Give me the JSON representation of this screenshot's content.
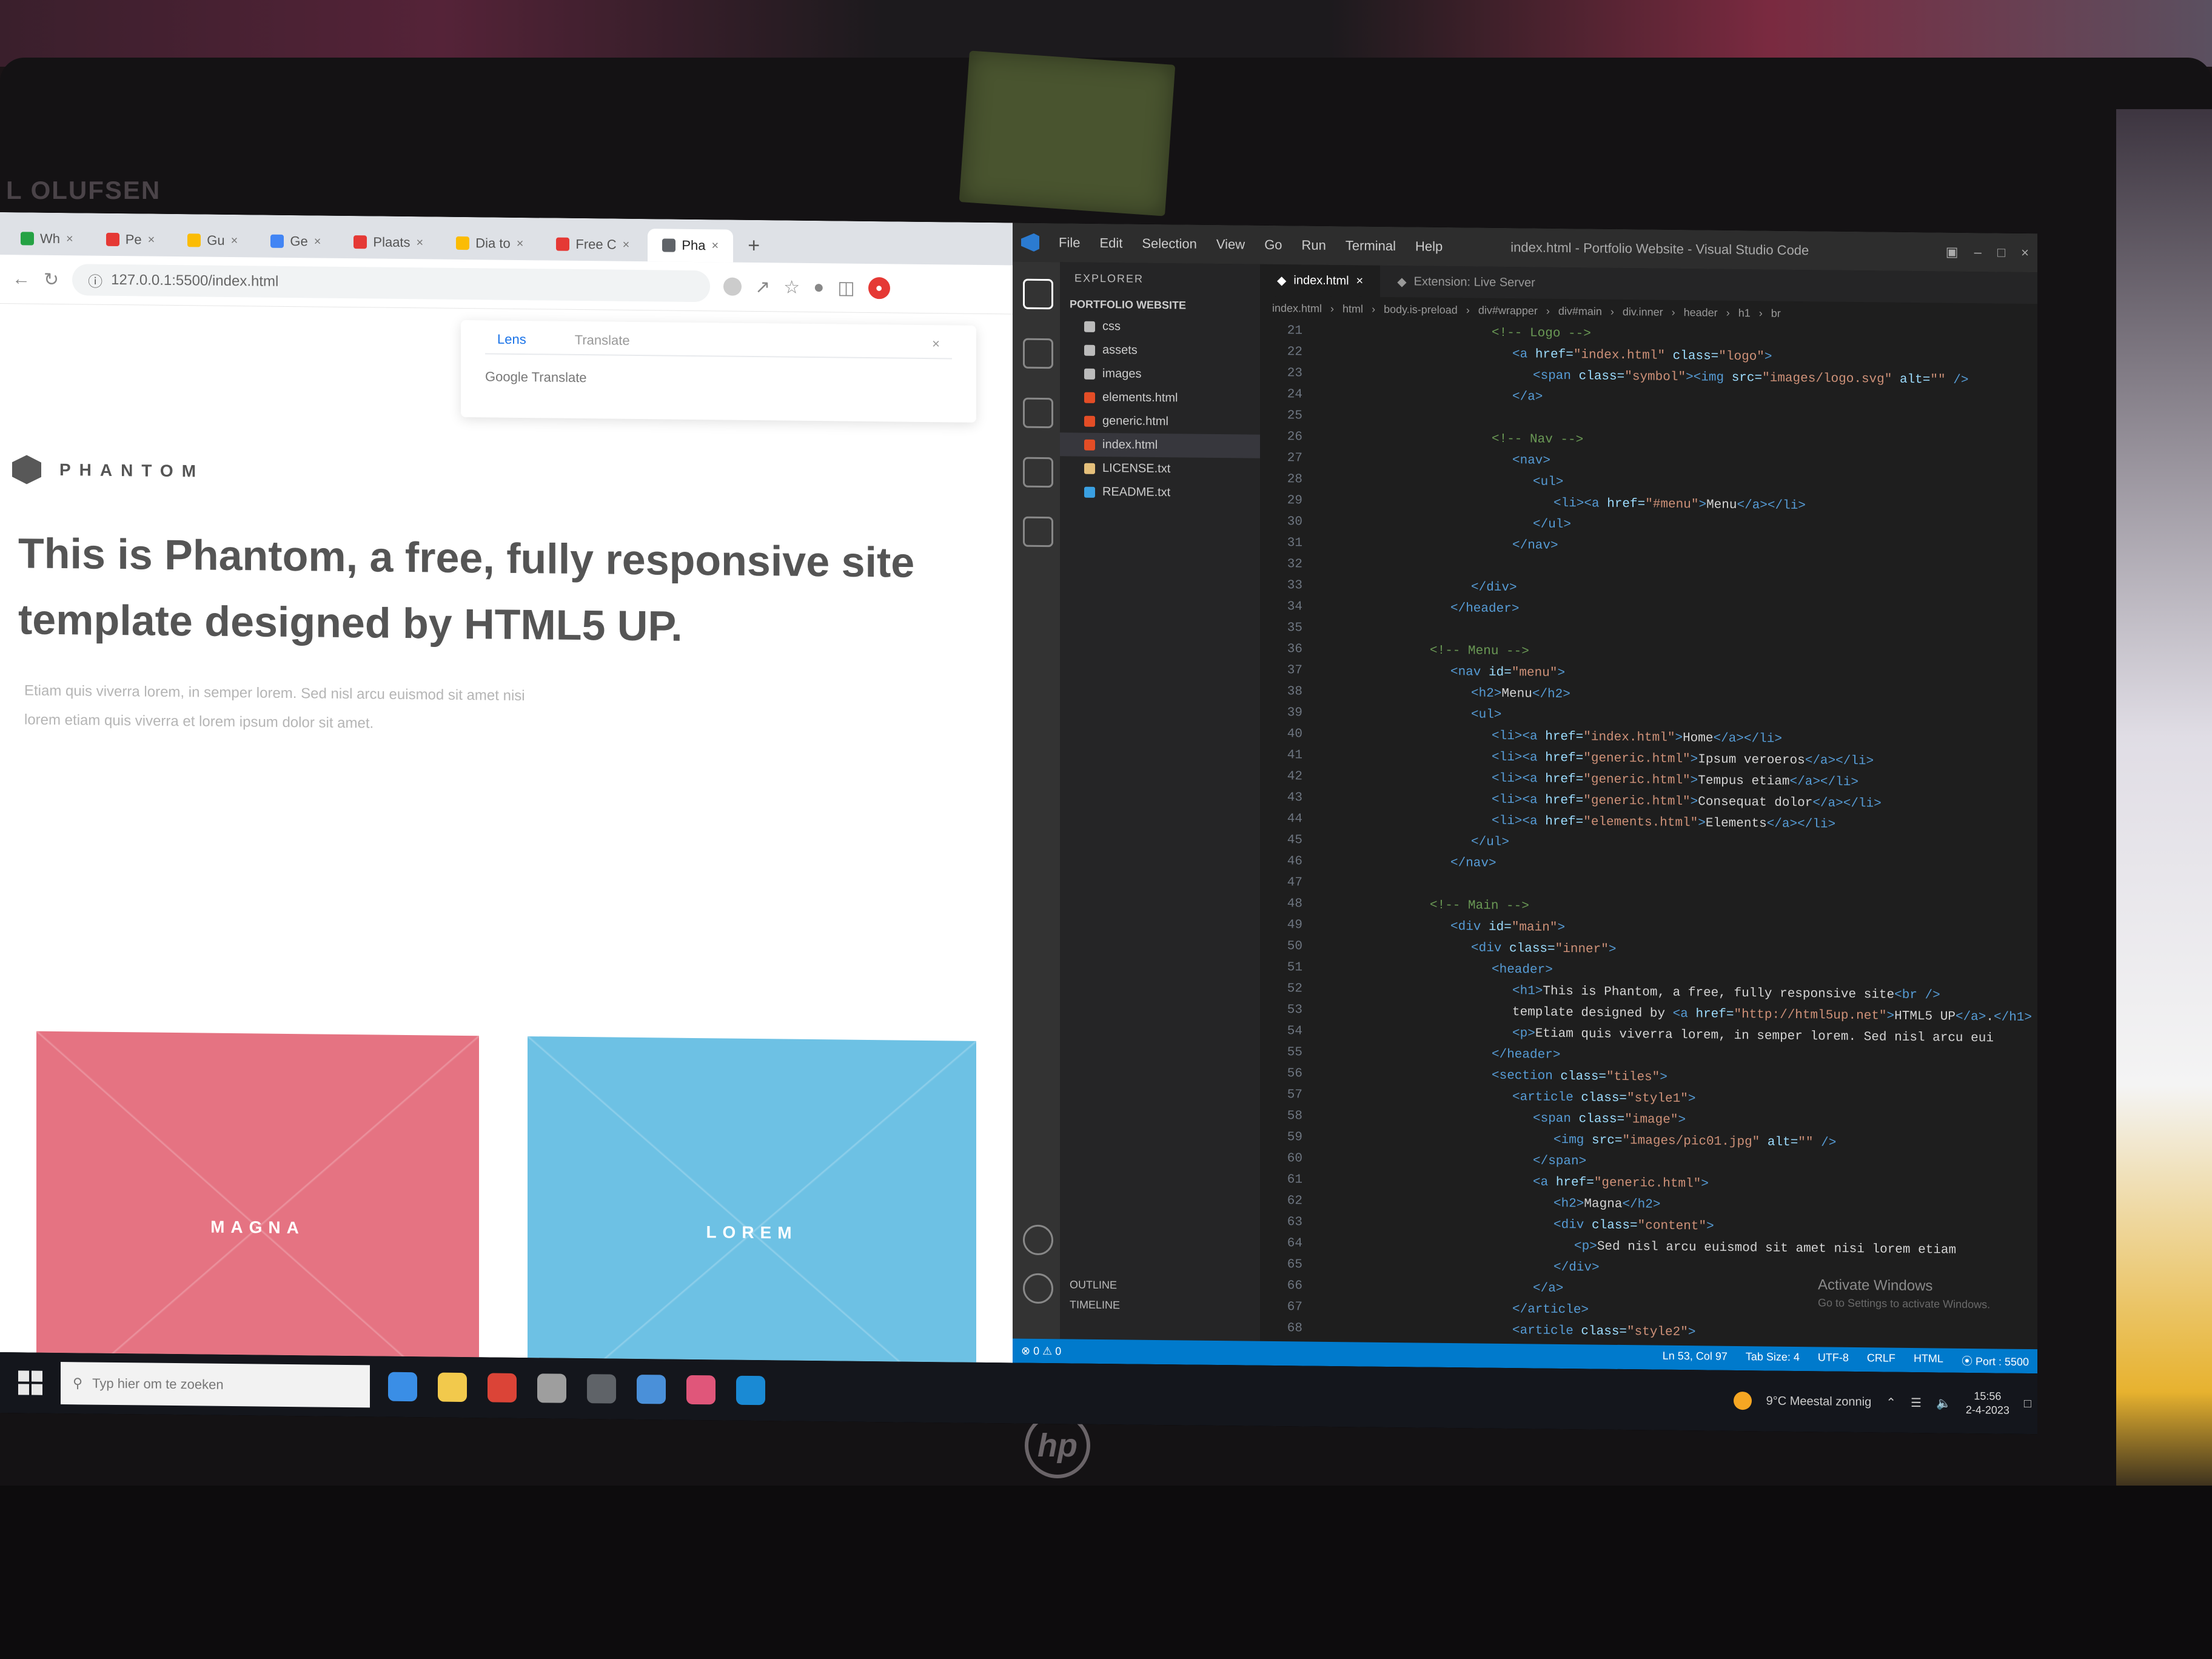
{
  "surroundings": {
    "monitor_brand": "L OLUFSEN",
    "laptop_logo": "hp"
  },
  "browser": {
    "tabs": [
      {
        "label": "Wh",
        "color": "#25a244"
      },
      {
        "label": "Pe",
        "color": "#e53935"
      },
      {
        "label": "Gu",
        "color": "#fbbc04"
      },
      {
        "label": "Ge",
        "color": "#4285f4"
      },
      {
        "label": "Plaats",
        "color": "#e53935"
      },
      {
        "label": "Dia to",
        "color": "#fbbc04"
      },
      {
        "label": "Free C",
        "color": "#e53935"
      },
      {
        "label": "Pha",
        "color": "#5f6368",
        "active": true
      }
    ],
    "address": "127.0.0.1:5500/index.html",
    "popup": {
      "tab_active": "Lens",
      "tab_other": "Translate",
      "source": "Google Translate"
    },
    "site": {
      "logo_text": "PHANTOM",
      "hero_line1": "This is Phantom, a free, fully responsive site",
      "hero_line2": "template designed by HTML5 UP.",
      "lead_line1": "Etiam quis viverra lorem, in semper lorem. Sed nisl arcu euismod sit amet nisi",
      "lead_line2": "lorem etiam quis viverra et lorem ipsum dolor sit amet.",
      "tiles": [
        {
          "label": "MAGNA",
          "color": "#e57382"
        },
        {
          "label": "LOREM",
          "color": "#6dc1e4"
        },
        {
          "label": "",
          "color": "#3eb08a"
        },
        {
          "label": "",
          "color": "#c766a8"
        }
      ]
    }
  },
  "vscode": {
    "menu": [
      "File",
      "Edit",
      "Selection",
      "View",
      "Go",
      "Run",
      "Terminal",
      "Help"
    ],
    "window_title": "index.html - Portfolio Website - Visual Studio Code",
    "sidebar": {
      "header": "EXPLORER",
      "project": "PORTFOLIO WEBSITE",
      "items": [
        {
          "label": "css",
          "color": "#bbb"
        },
        {
          "label": "assets",
          "color": "#bbb"
        },
        {
          "label": "images",
          "color": "#bbb"
        },
        {
          "label": "elements.html",
          "color": "#e44d26"
        },
        {
          "label": "generic.html",
          "color": "#e44d26"
        },
        {
          "label": "index.html",
          "color": "#e44d26",
          "selected": true
        },
        {
          "label": "LICENSE.txt",
          "color": "#e5c07b"
        },
        {
          "label": "README.txt",
          "color": "#3aa0e2"
        }
      ],
      "outline": "OUTLINE",
      "timeline": "TIMELINE"
    },
    "tabs": [
      {
        "label": "index.html",
        "active": true
      },
      {
        "label": "Extension: Live Server",
        "active": false
      }
    ],
    "breadcrumbs": [
      "index.html",
      "html",
      "body.is-preload",
      "div#wrapper",
      "div#main",
      "div.inner",
      "header",
      "h1",
      "br"
    ],
    "code": [
      {
        "n": "21",
        "t": [
          [
            "cm",
            "<!-- Logo -->"
          ]
        ],
        "i": 8
      },
      {
        "n": "22",
        "t": [
          [
            "tag",
            "<a "
          ],
          [
            "at",
            "href="
          ],
          [
            "st",
            "\"index.html\""
          ],
          [
            "at",
            " class="
          ],
          [
            "st",
            "\"logo\""
          ],
          [
            "tag",
            ">"
          ]
        ],
        "i": 9
      },
      {
        "n": "23",
        "t": [
          [
            "tag",
            "<span "
          ],
          [
            "at",
            "class="
          ],
          [
            "st",
            "\"symbol\""
          ],
          [
            "tag",
            "><img "
          ],
          [
            "at",
            "src="
          ],
          [
            "st",
            "\"images/logo.svg\""
          ],
          [
            "at",
            " alt="
          ],
          [
            "st",
            "\"\""
          ],
          [
            "tag",
            " />"
          ]
        ],
        "i": 10
      },
      {
        "n": "24",
        "t": [
          [
            "tag",
            "</a>"
          ]
        ],
        "i": 9
      },
      {
        "n": "25",
        "t": [],
        "i": 0
      },
      {
        "n": "26",
        "t": [
          [
            "cm",
            "<!-- Nav -->"
          ]
        ],
        "i": 8
      },
      {
        "n": "27",
        "t": [
          [
            "tag",
            "<nav>"
          ]
        ],
        "i": 9
      },
      {
        "n": "28",
        "t": [
          [
            "tag",
            "<ul>"
          ]
        ],
        "i": 10
      },
      {
        "n": "29",
        "t": [
          [
            "tag",
            "<li><a "
          ],
          [
            "at",
            "href="
          ],
          [
            "st",
            "\"#menu\""
          ],
          [
            "tag",
            ">"
          ],
          [
            "tx",
            "Menu"
          ],
          [
            "tag",
            "</a></li>"
          ]
        ],
        "i": 11
      },
      {
        "n": "30",
        "t": [
          [
            "tag",
            "</ul>"
          ]
        ],
        "i": 10
      },
      {
        "n": "31",
        "t": [
          [
            "tag",
            "</nav>"
          ]
        ],
        "i": 9
      },
      {
        "n": "32",
        "t": [],
        "i": 0
      },
      {
        "n": "33",
        "t": [
          [
            "tag",
            "</div>"
          ]
        ],
        "i": 7
      },
      {
        "n": "34",
        "t": [
          [
            "tag",
            "</header>"
          ]
        ],
        "i": 6
      },
      {
        "n": "35",
        "t": [],
        "i": 0
      },
      {
        "n": "36",
        "t": [
          [
            "cm",
            "<!-- Menu -->"
          ]
        ],
        "i": 5
      },
      {
        "n": "37",
        "t": [
          [
            "tag",
            "<nav "
          ],
          [
            "at",
            "id="
          ],
          [
            "st",
            "\"menu\""
          ],
          [
            "tag",
            ">"
          ]
        ],
        "i": 6
      },
      {
        "n": "38",
        "t": [
          [
            "tag",
            "<h2>"
          ],
          [
            "tx",
            "Menu"
          ],
          [
            "tag",
            "</h2>"
          ]
        ],
        "i": 7
      },
      {
        "n": "39",
        "t": [
          [
            "tag",
            "<ul>"
          ]
        ],
        "i": 7
      },
      {
        "n": "40",
        "t": [
          [
            "tag",
            "<li><a "
          ],
          [
            "at",
            "href="
          ],
          [
            "st",
            "\"index.html\""
          ],
          [
            "tag",
            ">"
          ],
          [
            "tx",
            "Home"
          ],
          [
            "tag",
            "</a></li>"
          ]
        ],
        "i": 8
      },
      {
        "n": "41",
        "t": [
          [
            "tag",
            "<li><a "
          ],
          [
            "at",
            "href="
          ],
          [
            "st",
            "\"generic.html\""
          ],
          [
            "tag",
            ">"
          ],
          [
            "tx",
            "Ipsum veroeros"
          ],
          [
            "tag",
            "</a></li>"
          ]
        ],
        "i": 8
      },
      {
        "n": "42",
        "t": [
          [
            "tag",
            "<li><a "
          ],
          [
            "at",
            "href="
          ],
          [
            "st",
            "\"generic.html\""
          ],
          [
            "tag",
            ">"
          ],
          [
            "tx",
            "Tempus etiam"
          ],
          [
            "tag",
            "</a></li>"
          ]
        ],
        "i": 8
      },
      {
        "n": "43",
        "t": [
          [
            "tag",
            "<li><a "
          ],
          [
            "at",
            "href="
          ],
          [
            "st",
            "\"generic.html\""
          ],
          [
            "tag",
            ">"
          ],
          [
            "tx",
            "Consequat dolor"
          ],
          [
            "tag",
            "</a></li>"
          ]
        ],
        "i": 8
      },
      {
        "n": "44",
        "t": [
          [
            "tag",
            "<li><a "
          ],
          [
            "at",
            "href="
          ],
          [
            "st",
            "\"elements.html\""
          ],
          [
            "tag",
            ">"
          ],
          [
            "tx",
            "Elements"
          ],
          [
            "tag",
            "</a></li>"
          ]
        ],
        "i": 8
      },
      {
        "n": "45",
        "t": [
          [
            "tag",
            "</ul>"
          ]
        ],
        "i": 7
      },
      {
        "n": "46",
        "t": [
          [
            "tag",
            "</nav>"
          ]
        ],
        "i": 6
      },
      {
        "n": "47",
        "t": [],
        "i": 0
      },
      {
        "n": "48",
        "t": [
          [
            "cm",
            "<!-- Main -->"
          ]
        ],
        "i": 5
      },
      {
        "n": "49",
        "t": [
          [
            "tag",
            "<div "
          ],
          [
            "at",
            "id="
          ],
          [
            "st",
            "\"main\""
          ],
          [
            "tag",
            ">"
          ]
        ],
        "i": 6
      },
      {
        "n": "50",
        "t": [
          [
            "tag",
            "<div "
          ],
          [
            "at",
            "class="
          ],
          [
            "st",
            "\"inner\""
          ],
          [
            "tag",
            ">"
          ]
        ],
        "i": 7
      },
      {
        "n": "51",
        "t": [
          [
            "tag",
            "<header>"
          ]
        ],
        "i": 8
      },
      {
        "n": "52",
        "t": [
          [
            "tag",
            "<h1>"
          ],
          [
            "tx",
            "This is Phantom, a free, fully responsive site"
          ],
          [
            "tag",
            "<br />"
          ]
        ],
        "i": 9
      },
      {
        "n": "53",
        "t": [
          [
            "tx",
            "template designed by "
          ],
          [
            "tag",
            "<a "
          ],
          [
            "at",
            "href="
          ],
          [
            "st",
            "\"http://html5up.net\""
          ],
          [
            "tag",
            ">"
          ],
          [
            "tx",
            "HTML5 UP"
          ],
          [
            "tag",
            "</a>"
          ],
          [
            "tx",
            "."
          ],
          [
            "tag",
            "</h1>"
          ]
        ],
        "i": 9
      },
      {
        "n": "54",
        "t": [
          [
            "tag",
            "<p>"
          ],
          [
            "tx",
            "Etiam quis viverra lorem, in semper lorem. Sed nisl arcu eui"
          ]
        ],
        "i": 9
      },
      {
        "n": "55",
        "t": [
          [
            "tag",
            "</header>"
          ]
        ],
        "i": 8
      },
      {
        "n": "56",
        "t": [
          [
            "tag",
            "<section "
          ],
          [
            "at",
            "class="
          ],
          [
            "st",
            "\"tiles\""
          ],
          [
            "tag",
            ">"
          ]
        ],
        "i": 8
      },
      {
        "n": "57",
        "t": [
          [
            "tag",
            "<article "
          ],
          [
            "at",
            "class="
          ],
          [
            "st",
            "\"style1\""
          ],
          [
            "tag",
            ">"
          ]
        ],
        "i": 9
      },
      {
        "n": "58",
        "t": [
          [
            "tag",
            "<span "
          ],
          [
            "at",
            "class="
          ],
          [
            "st",
            "\"image\""
          ],
          [
            "tag",
            ">"
          ]
        ],
        "i": 10
      },
      {
        "n": "59",
        "t": [
          [
            "tag",
            "<img "
          ],
          [
            "at",
            "src="
          ],
          [
            "st",
            "\"images/pic01.jpg\""
          ],
          [
            "at",
            " alt="
          ],
          [
            "st",
            "\"\""
          ],
          [
            "tag",
            " />"
          ]
        ],
        "i": 11
      },
      {
        "n": "60",
        "t": [
          [
            "tag",
            "</span>"
          ]
        ],
        "i": 10
      },
      {
        "n": "61",
        "t": [
          [
            "tag",
            "<a "
          ],
          [
            "at",
            "href="
          ],
          [
            "st",
            "\"generic.html\""
          ],
          [
            "tag",
            ">"
          ]
        ],
        "i": 10
      },
      {
        "n": "62",
        "t": [
          [
            "tag",
            "<h2>"
          ],
          [
            "tx",
            "Magna"
          ],
          [
            "tag",
            "</h2>"
          ]
        ],
        "i": 11
      },
      {
        "n": "63",
        "t": [
          [
            "tag",
            "<div "
          ],
          [
            "at",
            "class="
          ],
          [
            "st",
            "\"content\""
          ],
          [
            "tag",
            ">"
          ]
        ],
        "i": 11
      },
      {
        "n": "64",
        "t": [
          [
            "tag",
            "<p>"
          ],
          [
            "tx",
            "Sed nisl arcu euismod sit amet nisi lorem etiam"
          ]
        ],
        "i": 12
      },
      {
        "n": "65",
        "t": [
          [
            "tag",
            "</div>"
          ]
        ],
        "i": 11
      },
      {
        "n": "66",
        "t": [
          [
            "tag",
            "</a>"
          ]
        ],
        "i": 10
      },
      {
        "n": "67",
        "t": [
          [
            "tag",
            "</article>"
          ]
        ],
        "i": 9
      },
      {
        "n": "68",
        "t": [
          [
            "tag",
            "<article "
          ],
          [
            "at",
            "class="
          ],
          [
            "st",
            "\"style2\""
          ],
          [
            "tag",
            ">"
          ]
        ],
        "i": 9
      }
    ],
    "watermark_title": "Activate Windows",
    "watermark_sub": "Go to Settings to activate Windows.",
    "status_left": "⊗ 0 ⚠ 0",
    "status_right": [
      "Ln 53, Col 97",
      "Tab Size: 4",
      "UTF-8",
      "CRLF",
      "HTML",
      "⦿ Port : 5500"
    ]
  },
  "taskbar": {
    "search_placeholder": "Typ hier om te zoeken",
    "apps": [
      "#3a8ee6",
      "#f2c94c",
      "#db4437",
      "#9e9e9e",
      "#5f6368",
      "#4a90d9",
      "#e0567a",
      "#1a8ad4"
    ],
    "weather": "9°C Meestal zonnig",
    "time": "15:56",
    "date": "2-4-2023"
  }
}
